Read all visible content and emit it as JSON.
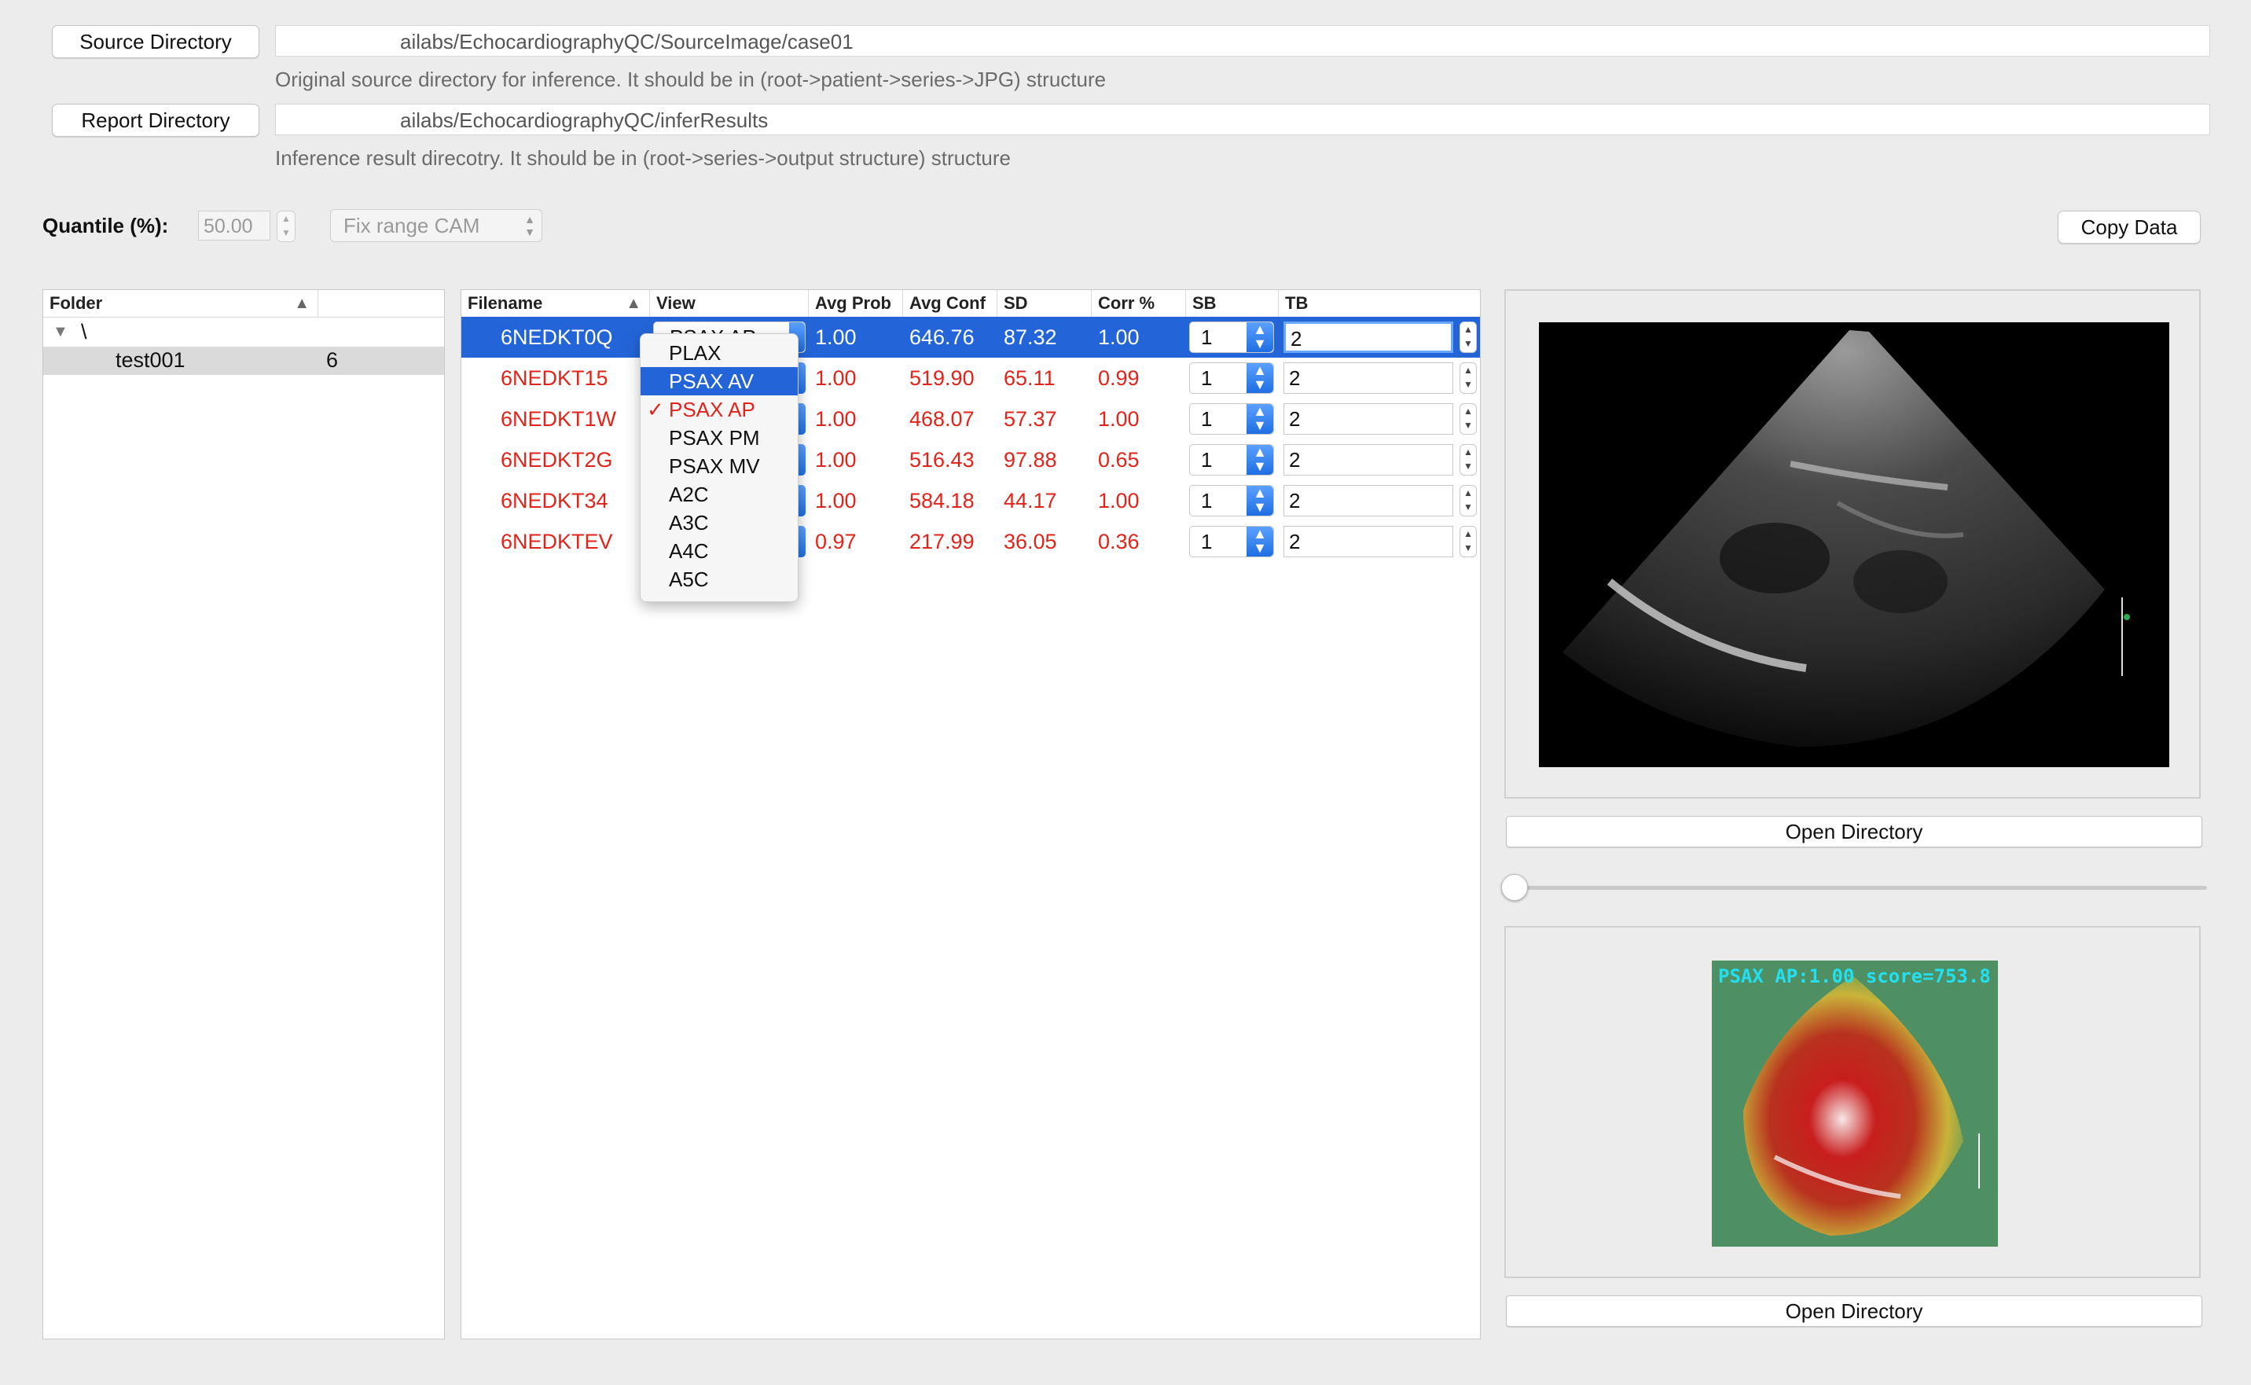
{
  "source": {
    "button_label": "Source Directory",
    "path": "ailabs/EchocardiographyQC/SourceImage/case01",
    "hint": "Original source directory for inference. It should be in (root->patient->series->JPG)   structure"
  },
  "report": {
    "button_label": "Report Directory",
    "path": "ailabs/EchocardiographyQC/inferResults",
    "hint": "Inference result direcotry. It should be in (root->series->output structure) structure"
  },
  "quantile": {
    "label": "Quantile (%):",
    "value": "50.00"
  },
  "cam_mode": {
    "selected": "Fix range CAM"
  },
  "copy_button": "Copy Data",
  "folder_tree": {
    "header": "Folder",
    "root": "\\",
    "items": [
      {
        "name": "test001",
        "count": "6"
      }
    ]
  },
  "table": {
    "columns": [
      "Filename",
      "View",
      "Avg Prob",
      "Avg Conf",
      "SD",
      "Corr %",
      "SB",
      "TB"
    ],
    "rows": [
      {
        "filename": "6NEDKT0Q",
        "view": "PSAX AP",
        "avg_prob": "1.00",
        "avg_conf": "646.76",
        "sd": "87.32",
        "corr": "1.00",
        "sb": "1",
        "tb": "2"
      },
      {
        "filename": "6NEDKT15",
        "view": "",
        "avg_prob": "1.00",
        "avg_conf": "519.90",
        "sd": "65.11",
        "corr": "0.99",
        "sb": "1",
        "tb": "2"
      },
      {
        "filename": "6NEDKT1W",
        "view": "",
        "avg_prob": "1.00",
        "avg_conf": "468.07",
        "sd": "57.37",
        "corr": "1.00",
        "sb": "1",
        "tb": "2"
      },
      {
        "filename": "6NEDKT2G",
        "view": "",
        "avg_prob": "1.00",
        "avg_conf": "516.43",
        "sd": "97.88",
        "corr": "0.65",
        "sb": "1",
        "tb": "2"
      },
      {
        "filename": "6NEDKT34",
        "view": "",
        "avg_prob": "1.00",
        "avg_conf": "584.18",
        "sd": "44.17",
        "corr": "1.00",
        "sb": "1",
        "tb": "2"
      },
      {
        "filename": "6NEDKTEV",
        "view": "",
        "avg_prob": "0.97",
        "avg_conf": "217.99",
        "sd": "36.05",
        "corr": "0.36",
        "sb": "1",
        "tb": "2"
      }
    ]
  },
  "view_menu": {
    "options": [
      "PLAX",
      "PSAX AV",
      "PSAX AP",
      "PSAX PM",
      "PSAX MV",
      "A2C",
      "A3C",
      "A4C",
      "A5C"
    ],
    "highlighted": "PSAX AV",
    "checked": "PSAX AP",
    "check_glyph": "✓"
  },
  "image_panel_top": {
    "open_button": "Open Directory"
  },
  "image_panel_bottom": {
    "open_button": "Open Directory",
    "overlay_text": "PSAX AP:1.00 score=753.8"
  },
  "slider": {
    "value": 0
  },
  "colors": {
    "selection": "#2365d8",
    "error_text": "#e2231a",
    "overlay_text": "#22e0f0"
  }
}
